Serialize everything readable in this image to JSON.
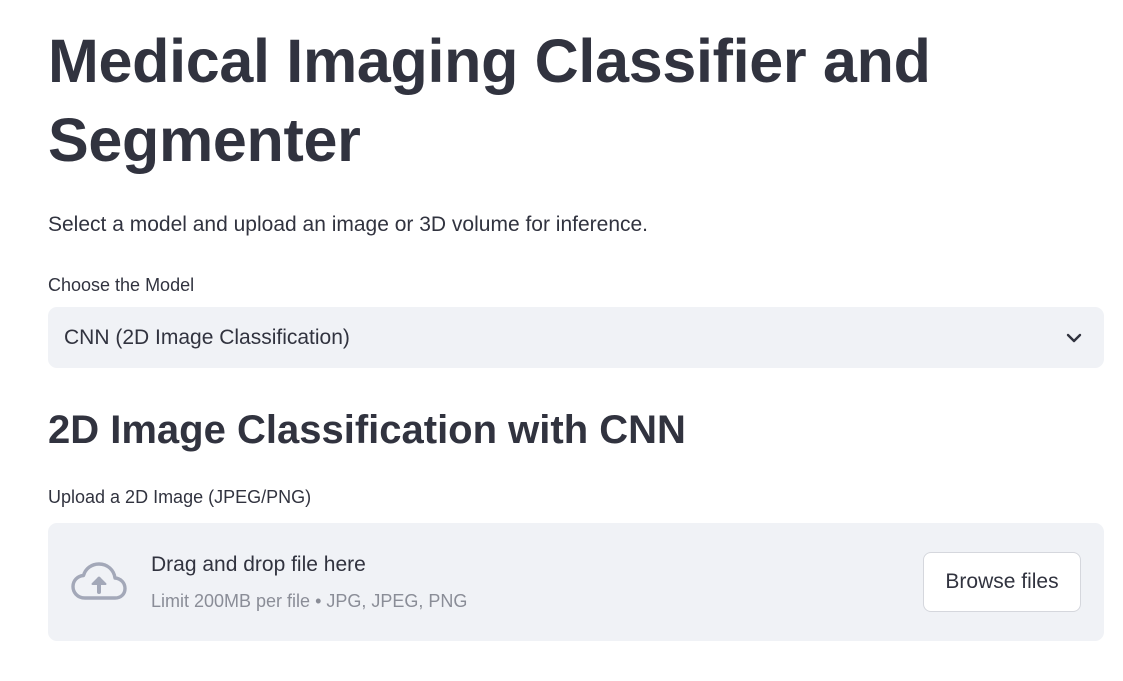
{
  "header": {
    "title": "Medical Imaging Classifier and Segmenter",
    "subtitle": "Select a model and upload an image or 3D volume for inference."
  },
  "model_select": {
    "label": "Choose the Model",
    "value": "CNN (2D Image Classification)",
    "icon": "chevron-down-icon"
  },
  "section": {
    "title": "2D Image Classification with CNN"
  },
  "uploader": {
    "label": "Upload a 2D Image (JPEG/PNG)",
    "drop_text": "Drag and drop file here",
    "limit_text": "Limit 200MB per file • JPG, JPEG, PNG",
    "browse_label": "Browse files",
    "icon": "cloud-upload-icon"
  },
  "colors": {
    "text": "#31333f",
    "muted": "#8a8d97",
    "panel": "#f0f2f6",
    "icon": "#a3a8b8"
  }
}
